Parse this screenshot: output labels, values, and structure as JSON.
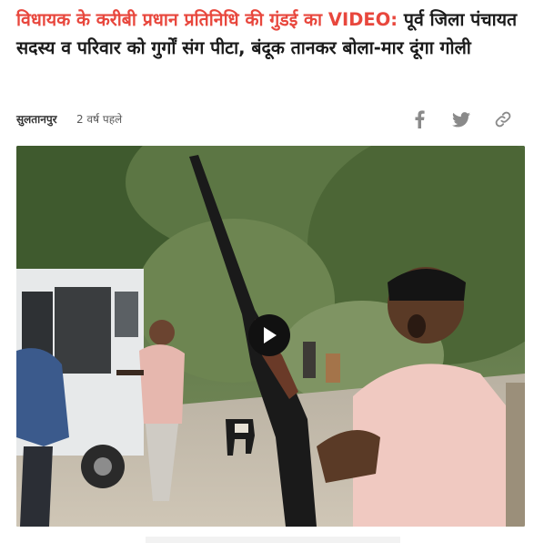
{
  "article": {
    "headline_highlight": "विधायक के करीबी प्रधान प्रतिनिधि की गुंडई का VIDEO:",
    "headline_rest": " पूर्व जिला पंचायत सदस्य व परिवार को गुर्गों संग पीटा, बंदूक तानकर बोला-मार दूंगा गोली",
    "city": "सुलतानपुर",
    "time_ago": "2 वर्ष पहले"
  },
  "share": {
    "icons": [
      "facebook-icon",
      "twitter-icon",
      "link-icon"
    ]
  },
  "video": {
    "state": "paused",
    "play_icon": "play-icon"
  },
  "colors": {
    "headline_highlight": "#e8473d",
    "headline_text": "#1b1b1b",
    "icon_gray": "#8a8a8a",
    "play_button": "#111111"
  }
}
